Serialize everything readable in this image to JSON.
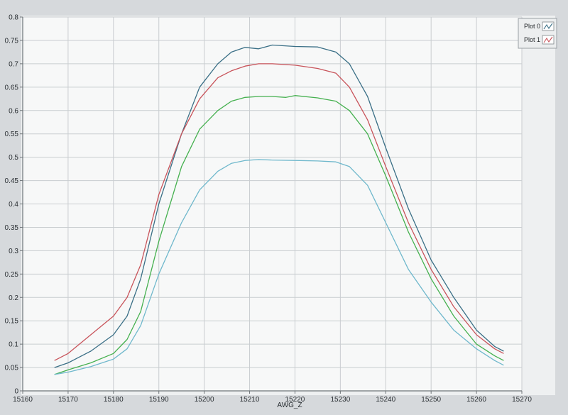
{
  "chart_data": {
    "type": "line",
    "xlabel": "AWG_Z",
    "ylabel": "",
    "xlim": [
      15160,
      15270
    ],
    "ylim": [
      0,
      0.8
    ],
    "x_ticks": [
      15160,
      15170,
      15180,
      15190,
      15200,
      15210,
      15220,
      15230,
      15240,
      15250,
      15260,
      15270
    ],
    "y_ticks": [
      0,
      0.05,
      0.1,
      0.15,
      0.2,
      0.25,
      0.3,
      0.35,
      0.4,
      0.45,
      0.5,
      0.55,
      0.6,
      0.65,
      0.7,
      0.75,
      0.8
    ],
    "y_tick_labels": [
      "0",
      "0.05",
      "0.1",
      "0.15",
      "0.2",
      "0.25",
      "0.3",
      "0.35",
      "0.4",
      "0.45",
      "0.5",
      "0.55",
      "0.6",
      "0.65",
      "0.7",
      "0.75",
      "0.8"
    ],
    "grid": true,
    "legend": {
      "position": "top-right",
      "entries": [
        {
          "name": "Plot 0",
          "color": "#3a6f86"
        },
        {
          "name": "Plot 1",
          "color": "#c8535a"
        }
      ]
    },
    "series": [
      {
        "name": "Plot 0",
        "color": "#3a6f86",
        "x": [
          15167,
          15170,
          15175,
          15180,
          15183,
          15186,
          15190,
          15195,
          15199,
          15203,
          15206,
          15209,
          15212,
          15215,
          15220,
          15225,
          15229,
          15232,
          15236,
          15240,
          15245,
          15250,
          15255,
          15260,
          15264,
          15266
        ],
        "y": [
          0.05,
          0.06,
          0.085,
          0.12,
          0.16,
          0.24,
          0.4,
          0.55,
          0.65,
          0.7,
          0.725,
          0.735,
          0.732,
          0.74,
          0.737,
          0.736,
          0.725,
          0.7,
          0.63,
          0.52,
          0.39,
          0.28,
          0.2,
          0.13,
          0.095,
          0.085
        ]
      },
      {
        "name": "Plot 1",
        "color": "#c8535a",
        "x": [
          15167,
          15170,
          15175,
          15180,
          15183,
          15186,
          15190,
          15195,
          15199,
          15203,
          15206,
          15209,
          15212,
          15215,
          15220,
          15225,
          15229,
          15232,
          15236,
          15240,
          15245,
          15250,
          15255,
          15260,
          15264,
          15266
        ],
        "y": [
          0.065,
          0.08,
          0.12,
          0.16,
          0.2,
          0.27,
          0.42,
          0.55,
          0.625,
          0.67,
          0.685,
          0.695,
          0.7,
          0.7,
          0.697,
          0.69,
          0.68,
          0.65,
          0.58,
          0.48,
          0.36,
          0.26,
          0.18,
          0.12,
          0.09,
          0.08
        ]
      },
      {
        "name": "",
        "color": "#44b04e",
        "x": [
          15167,
          15170,
          15175,
          15180,
          15183,
          15186,
          15190,
          15195,
          15199,
          15203,
          15206,
          15209,
          15212,
          15215,
          15218,
          15220,
          15225,
          15229,
          15232,
          15236,
          15240,
          15245,
          15250,
          15255,
          15260,
          15264,
          15266
        ],
        "y": [
          0.035,
          0.045,
          0.06,
          0.08,
          0.11,
          0.17,
          0.32,
          0.48,
          0.56,
          0.6,
          0.62,
          0.628,
          0.63,
          0.63,
          0.628,
          0.632,
          0.627,
          0.62,
          0.6,
          0.55,
          0.46,
          0.34,
          0.24,
          0.16,
          0.1,
          0.075,
          0.065
        ]
      },
      {
        "name": "",
        "color": "#6fb8cc",
        "x": [
          15167,
          15170,
          15175,
          15180,
          15183,
          15186,
          15190,
          15195,
          15199,
          15203,
          15206,
          15209,
          15212,
          15215,
          15220,
          15225,
          15229,
          15232,
          15236,
          15240,
          15245,
          15250,
          15255,
          15260,
          15264,
          15266
        ],
        "y": [
          0.035,
          0.04,
          0.052,
          0.068,
          0.09,
          0.14,
          0.25,
          0.36,
          0.43,
          0.47,
          0.487,
          0.493,
          0.495,
          0.494,
          0.493,
          0.492,
          0.49,
          0.48,
          0.44,
          0.36,
          0.26,
          0.19,
          0.13,
          0.09,
          0.065,
          0.055
        ]
      }
    ]
  }
}
